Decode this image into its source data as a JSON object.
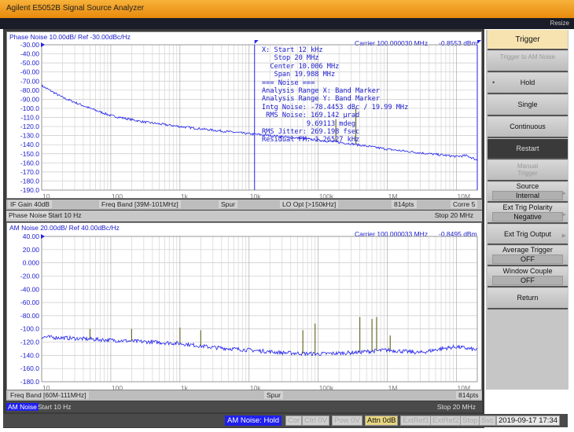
{
  "window": {
    "title": "Agilent E5052B Signal Source Analyzer",
    "resize": "Resize"
  },
  "phase_panel": {
    "title": "Phase Noise 10.00dB/ Ref -30.00dBc/Hz",
    "carrier": "Carrier 100.000030 MHz",
    "power": "-0.8553 dBm",
    "info": [
      "X: Start 12 kHz",
      "   Stop 20 MHz",
      "  Center 10.006 MHz",
      "   Span 19.988 MHz",
      "=== Noise ===",
      "Analysis Range X: Band Marker",
      "Analysis Range Y: Band Marker",
      "Intg Noise: -78.4453 dBc / 19.99 MHz",
      " RMS Noise: 169.142 µrad",
      "           9.69113 mdeg",
      "RMS Jitter: 269.198 fsec",
      "Residual FM: 1.26527 kHz"
    ],
    "status": [
      "IF Gain 40dB",
      "Freq Band [39M-101MHz]",
      "Spur",
      "LO Opt [>150kHz]",
      "814pts",
      "Corre 5"
    ],
    "mode": "Phase Noise",
    "start": "Start 10 Hz",
    "stop": "Stop 20 MHz"
  },
  "am_panel": {
    "title": "AM Noise 20.00dB/ Ref 40.00dBc/Hz",
    "carrier": "Carrier 100.000033 MHz",
    "power": "-0.8495 dBm",
    "status": [
      "Freq Band [60M-111MHz]",
      "Spur",
      "814pts"
    ],
    "mode": "AM Noise",
    "start": "Start 10 Hz",
    "stop": "Stop 20 MHz"
  },
  "chart_data": [
    {
      "type": "line",
      "title": "Phase Noise 10.00dB/ Ref -30.00dBc/Hz",
      "xscale": "log",
      "xlim": [
        10,
        20000000
      ],
      "ylim": [
        -190,
        -30
      ],
      "yticks": [
        "-30.00",
        "-40.00",
        "-50.00",
        "-60.00",
        "-70.00",
        "-80.00",
        "-90.00",
        "-100.0",
        "-110.0",
        "-120.0",
        "-130.0",
        "-140.0",
        "-150.0",
        "-160.0",
        "-170.0",
        "-180.0",
        "-190.0"
      ],
      "xticks": [
        "10",
        "100",
        "1k",
        "10k",
        "100k",
        "1M",
        "10M"
      ],
      "series": [
        {
          "color": "#2222ee",
          "x": [
            10,
            20,
            50,
            100,
            300,
            1000,
            3000,
            10000,
            30000,
            100000,
            300000,
            1000000,
            3000000,
            10000000,
            14000000,
            20000000
          ],
          "y": [
            -75,
            -88,
            -100,
            -108,
            -115,
            -120,
            -124,
            -128,
            -131,
            -135,
            -139,
            -145,
            -149,
            -153,
            -152,
            -157
          ]
        }
      ],
      "spurs": [
        {
          "x": 400,
          "y": -115
        },
        {
          "x": 600,
          "y": -117
        },
        {
          "x": 180000,
          "y": -112
        },
        {
          "x": 350000,
          "y": -100
        }
      ],
      "markers": [
        {
          "x": 12000
        },
        {
          "x": 20000000
        }
      ]
    },
    {
      "type": "line",
      "title": "AM Noise 20.00dB/ Ref 40.00dBc/Hz",
      "xscale": "log",
      "xlim": [
        10,
        20000000
      ],
      "ylim": [
        -180,
        40
      ],
      "yticks": [
        "40.00",
        "20.00",
        "0.000",
        "-20.00",
        "-40.00",
        "-60.00",
        "-80.00",
        "-100.0",
        "-120.0",
        "-140.0",
        "-160.0",
        "-180.0"
      ],
      "xticks": [
        "10",
        "100",
        "1k",
        "10k",
        "100k",
        "1M",
        "10M"
      ],
      "series": [
        {
          "color": "#2222ee",
          "x": [
            10,
            100,
            1000,
            3000,
            10000,
            30000,
            100000,
            300000,
            1000000,
            3000000,
            6000000,
            10000000,
            20000000
          ],
          "y": [
            -112,
            -117,
            -122,
            -128,
            -132,
            -136,
            -138,
            -136,
            -132,
            -136,
            -130,
            -127,
            -132
          ]
        }
      ],
      "spurs": [
        {
          "x": 50,
          "y": -100
        },
        {
          "x": 200,
          "y": -100
        },
        {
          "x": 1000,
          "y": -98
        },
        {
          "x": 2000,
          "y": -102
        },
        {
          "x": 60000,
          "y": -102
        },
        {
          "x": 90000,
          "y": -92
        },
        {
          "x": 400000,
          "y": -82
        },
        {
          "x": 600000,
          "y": -85
        },
        {
          "x": 700000,
          "y": -82
        },
        {
          "x": 1100000,
          "y": -110
        }
      ]
    }
  ],
  "softkeys": {
    "title": "Trigger",
    "trigger_to": "Trigger to AM Noise",
    "hold": "Hold",
    "single": "Single",
    "continuous": "Continuous",
    "restart": "Restart",
    "manual": "Manual Trigger",
    "source": "Source",
    "source_val": "Internal",
    "polarity": "Ext Trig Polarity",
    "polarity_val": "Negative",
    "output": "Ext Trig Output",
    "avg": "Average Trigger",
    "avg_val": "OFF",
    "window": "Window Couple",
    "window_val": "OFF",
    "return": "Return"
  },
  "statusbar": {
    "mode": "AM Noise: Hold",
    "cor": "Cor",
    "ctrl": "Ctrl  0V",
    "pow": "Pow  0V",
    "attn": "Attn 0dB",
    "ext1": "ExtRef1",
    "ext2": "ExtRef2",
    "stop": "Stop",
    "svc": "Svc",
    "datetime": "2019-09-17 17:34"
  },
  "colors": {
    "trace": "#2222ee",
    "spur": "#6b6b2a",
    "title_bar": "#f0a020",
    "active_key": "#f7e3b0"
  }
}
